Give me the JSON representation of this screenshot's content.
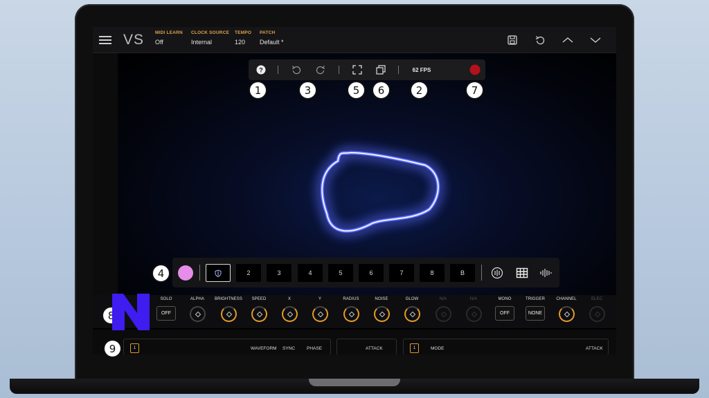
{
  "app": {
    "logo": "VS",
    "meta": [
      {
        "label": "MIDI LEARN",
        "value": "Off"
      },
      {
        "label": "CLOCK SOURCE",
        "value": "Internal"
      },
      {
        "label": "TEMPO",
        "value": "120"
      },
      {
        "label": "PATCH",
        "value": "Default *"
      }
    ],
    "top_icons": [
      "save-icon",
      "undo-icon",
      "chevron-up-icon",
      "chevron-down-icon"
    ]
  },
  "toolbar": {
    "fps": "62 FPS",
    "icons": [
      "help-icon",
      "undo-icon",
      "redo-icon",
      "fullscreen-icon",
      "copy-icon",
      "record-icon"
    ]
  },
  "callouts": [
    "1",
    "3",
    "5",
    "6",
    "2",
    "7",
    "4",
    "8",
    "9"
  ],
  "presets": {
    "swatch_color": "#e58de9",
    "buttons": [
      "2",
      "3",
      "4",
      "5",
      "6",
      "7",
      "8",
      "B"
    ],
    "icons": [
      "waveform-circle-icon",
      "grid-icon",
      "audio-bars-icon"
    ]
  },
  "controls": {
    "items": [
      {
        "label": "SOLO",
        "kind": "button",
        "value": "OFF"
      },
      {
        "label": "ALPHA",
        "kind": "knob"
      },
      {
        "label": "BRIGHTNESS",
        "kind": "knob"
      },
      {
        "label": "SPEED",
        "kind": "knob"
      },
      {
        "label": "X",
        "kind": "knob"
      },
      {
        "label": "Y",
        "kind": "knob"
      },
      {
        "label": "RADIUS",
        "kind": "knob"
      },
      {
        "label": "NOISE",
        "kind": "knob"
      },
      {
        "label": "GLOW",
        "kind": "knob"
      },
      {
        "label": "N/A",
        "kind": "knob-dim"
      },
      {
        "label": "N/A",
        "kind": "knob-dim"
      },
      {
        "label": "MONO",
        "kind": "button",
        "value": "OFF"
      },
      {
        "label": "TRIGGER",
        "kind": "button",
        "value": "NONE"
      },
      {
        "label": "CHANNEL",
        "kind": "knob"
      },
      {
        "label": "ELEC",
        "kind": "knob-dim"
      }
    ]
  },
  "lfo": {
    "left_num": "1",
    "left_labels": [
      "WAVEFORM",
      "SYNC",
      "PHASE"
    ],
    "mid_label": "ATTACK",
    "right_num": "1",
    "right_labels": [
      "MODE",
      "ATTACK"
    ]
  },
  "colors": {
    "accent_orange": "#e0a24a",
    "glow_blue": "#5a6bff",
    "record_red": "#b3121a",
    "brand_purple": "#3f1cf0"
  }
}
